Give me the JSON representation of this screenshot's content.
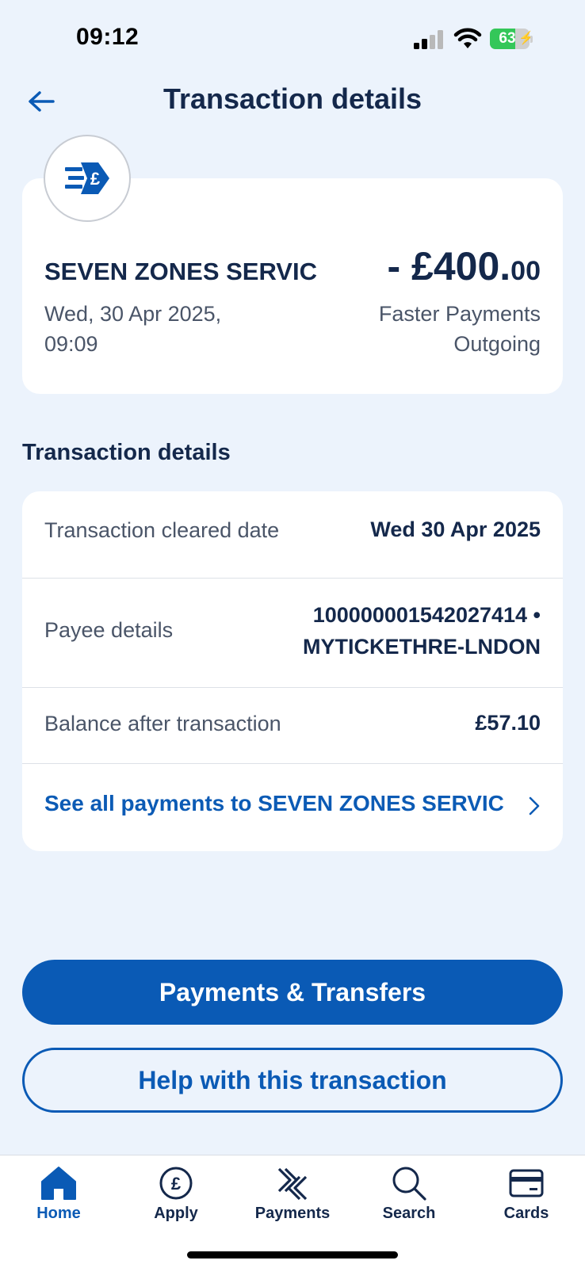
{
  "status_bar": {
    "time": "09:12",
    "battery_level": "63",
    "battery_fraction": 0.63
  },
  "header": {
    "title": "Transaction details",
    "back_icon": "arrow-left-icon"
  },
  "summary": {
    "merchant_icon": "faster-payment-pound-icon",
    "merchant_name": "SEVEN ZONES SERVIC",
    "date_line1": "Wed, 30 Apr 2025,",
    "date_line2": "09:09",
    "amount_main": "- £400.",
    "amount_pence": "00",
    "payment_type_line1": "Faster Payments",
    "payment_type_line2": "Outgoing"
  },
  "details": {
    "heading": "Transaction details",
    "rows": [
      {
        "label": "Transaction cleared date",
        "value_line1": "Wed 30 Apr 2025",
        "value_line2": ""
      },
      {
        "label": "Payee details",
        "value_line1": "100000001542027414 •",
        "value_line2": "MYTICKETHRE-LNDON"
      },
      {
        "label": "Balance after transaction",
        "value_line1": "£57.10",
        "value_line2": ""
      }
    ],
    "see_all_label": "See all payments to SEVEN ZONES SERVIC",
    "see_all_icon": "chevron-right-icon"
  },
  "actions": {
    "primary_label": "Payments & Transfers",
    "secondary_label": "Help with this transaction"
  },
  "nav": {
    "items": [
      {
        "label": "Home",
        "icon": "home-icon",
        "active": true
      },
      {
        "label": "Apply",
        "icon": "pound-circle-icon",
        "active": false
      },
      {
        "label": "Payments",
        "icon": "payments-icon",
        "active": false
      },
      {
        "label": "Search",
        "icon": "search-icon",
        "active": false
      },
      {
        "label": "Cards",
        "icon": "card-icon",
        "active": false
      }
    ]
  },
  "colors": {
    "background": "#ecf3fc",
    "primary": "#0a5ab5",
    "text_dark": "#14284b",
    "text_muted": "#4a5568",
    "battery_green": "#34c759"
  }
}
